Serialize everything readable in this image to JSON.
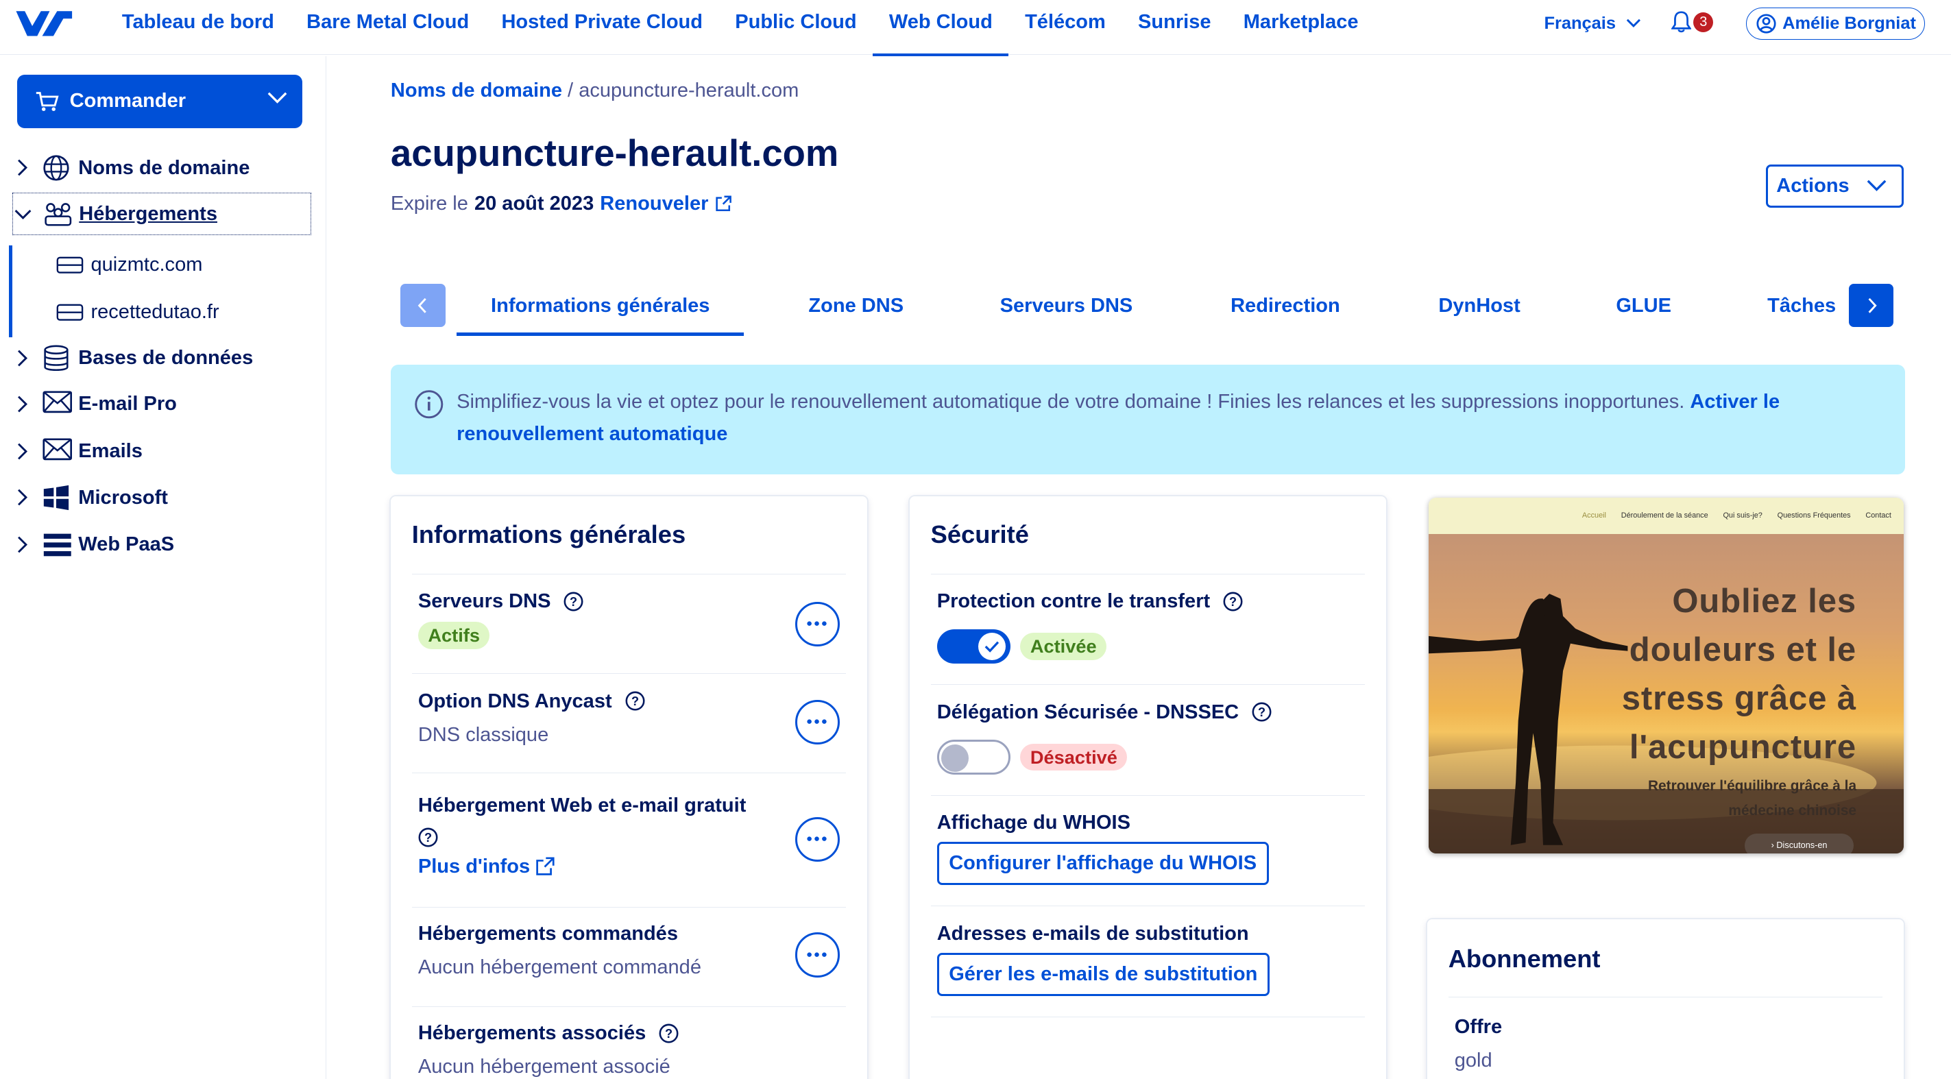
{
  "nav": {
    "items": [
      "Tableau de bord",
      "Bare Metal Cloud",
      "Hosted Private Cloud",
      "Public Cloud",
      "Web Cloud",
      "Télécom",
      "Sunrise",
      "Marketplace"
    ],
    "active": "Web Cloud",
    "language": "Français",
    "notifications_count": "3",
    "user": "Amélie Borgniat"
  },
  "sidebar": {
    "order_button": "Commander",
    "items": [
      {
        "label": "Noms de domaine",
        "icon": "globe-icon"
      },
      {
        "label": "Hébergements",
        "icon": "hosting-icon"
      },
      {
        "label": "Bases de données",
        "icon": "database-icon"
      },
      {
        "label": "E-mail Pro",
        "icon": "mail-icon"
      },
      {
        "label": "Emails",
        "icon": "mail-icon"
      },
      {
        "label": "Microsoft",
        "icon": "windows-icon"
      },
      {
        "label": "Web PaaS",
        "icon": "layers-icon"
      }
    ],
    "sub_items": [
      "quizmtc.com",
      "recettedutao.fr"
    ]
  },
  "breadcrumb": {
    "parent": "Noms de domaine",
    "separator": "/",
    "current": "acupuncture-herault.com"
  },
  "page": {
    "title": "acupuncture-herault.com",
    "expire_prefix": "Expire le",
    "expire_date": "20 août 2023",
    "renew": "Renouveler",
    "actions": "Actions"
  },
  "tabs": [
    "Informations générales",
    "Zone DNS",
    "Serveurs DNS",
    "Redirection",
    "DynHost",
    "GLUE",
    "Tâches"
  ],
  "banner": {
    "text": "Simplifiez-vous la vie et optez pour le renouvellement automatique de votre domaine ! Finies les relances et les suppressions inopportunes.",
    "link": "Activer le renouvellement automatique"
  },
  "general": {
    "title": "Informations générales",
    "dns_servers": {
      "label": "Serveurs DNS",
      "status": "Actifs"
    },
    "anycast": {
      "label": "Option DNS Anycast",
      "value": "DNS classique"
    },
    "free_hosting": {
      "label": "Hébergement Web et e-mail gratuit",
      "link": "Plus d'infos"
    },
    "ordered": {
      "label": "Hébergements commandés",
      "value": "Aucun hébergement commandé"
    },
    "associated": {
      "label": "Hébergements associés",
      "value": "Aucun hébergement associé"
    }
  },
  "security": {
    "title": "Sécurité",
    "transfer": {
      "label": "Protection contre le transfert",
      "status": "Activée",
      "enabled": true
    },
    "dnssec": {
      "label": "Délégation Sécurisée - DNSSEC",
      "status": "Désactivé",
      "enabled": false
    },
    "whois": {
      "label": "Affichage du WHOIS",
      "button": "Configurer l'affichage du WHOIS"
    },
    "emails": {
      "label": "Adresses e-mails de substitution",
      "button": "Gérer les e-mails de substitution"
    }
  },
  "preview": {
    "nav": [
      "Accueil",
      "Déroulement de la séance",
      "Qui suis-je?",
      "Questions Fréquentes",
      "Contact"
    ],
    "headline": "Oubliez les douleurs et le stress grâce à l'acupuncture",
    "subline": "Retrouver l'équilibre grâce à la médecine chinoise",
    "button": "› Discutons-en"
  },
  "subscription": {
    "title": "Abonnement",
    "offer_label": "Offre",
    "offer_value": "gold"
  },
  "colors": {
    "primary": "#0050d7",
    "text": "#00185e",
    "banner": "#bef1ff",
    "success_bg": "#dff7c6",
    "error_bg": "#ffd6d8"
  }
}
